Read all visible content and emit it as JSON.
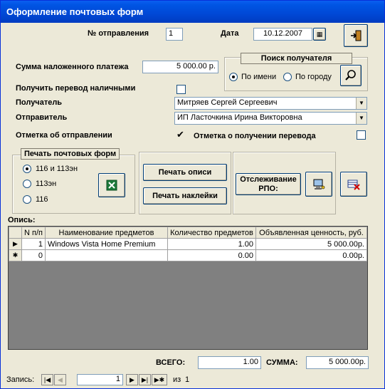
{
  "window": {
    "title": "Оформление почтовых форм"
  },
  "header": {
    "shipment_no_label": "№ отправления",
    "shipment_no_value": "1",
    "date_label": "Дата",
    "date_value": "10.12.2007"
  },
  "cod": {
    "label": "Сумма наложенного платежа",
    "value": "5 000.00 р."
  },
  "search": {
    "title": "Поиск получателя",
    "by_name": "По имени",
    "by_city": "По городу"
  },
  "cash_transfer": {
    "label": "Получить перевод наличными"
  },
  "recipient": {
    "label": "Получатель",
    "value": "Митряев Сергей Сергеевич"
  },
  "sender": {
    "label": "Отправитель",
    "value": "ИП Ласточкина Ирина Викторовна"
  },
  "sent_mark": {
    "label": "Отметка об отправлении",
    "check": "✔"
  },
  "received_mark": {
    "label": "Отметка о получении перевода"
  },
  "print_forms": {
    "title": "Печать почтовых форм",
    "options": [
      "116 и 113эн",
      "113эн",
      "116"
    ]
  },
  "buttons": {
    "print_inventory": "Печать описи",
    "print_stickers": "Печать наклейки",
    "tracking": "Отслеживание\nРПО:"
  },
  "inventory": {
    "label": "Опись:",
    "columns": [
      "N п/п",
      "Наименование предметов",
      "Количество предметов",
      "Объявленная ценность, руб."
    ],
    "rows": [
      {
        "marker": "▶",
        "n": "1",
        "name": "Windows Vista Home Premium",
        "qty": "1.00",
        "value": "5 000.00р."
      },
      {
        "marker": "✱",
        "n": "0",
        "name": "",
        "qty": "0.00",
        "value": "0.00р."
      }
    ]
  },
  "totals": {
    "total_label": "ВСЕГО:",
    "total_value": "1.00",
    "sum_label": "СУММА:",
    "sum_value": "5 000.00р."
  },
  "navigation": {
    "record_label": "Запись:",
    "current": "1",
    "of_label": "из",
    "total": "1"
  }
}
